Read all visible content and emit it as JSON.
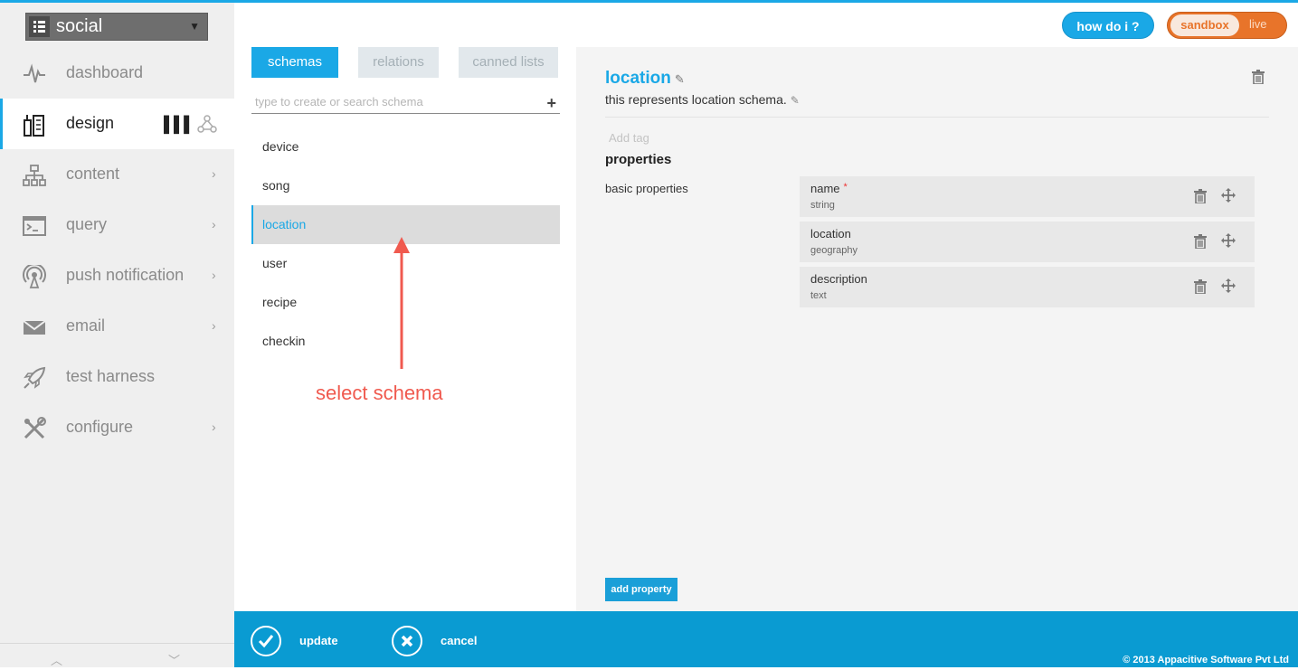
{
  "app_selector": {
    "label": "social"
  },
  "nav": [
    {
      "label": "dashboard",
      "icon": "pulse-icon",
      "chevron": false
    },
    {
      "label": "design",
      "icon": "design-icon",
      "chevron": false,
      "active": true
    },
    {
      "label": "content",
      "icon": "sitemap-icon",
      "chevron": true
    },
    {
      "label": "query",
      "icon": "terminal-icon",
      "chevron": true
    },
    {
      "label": "push notification",
      "icon": "broadcast-icon",
      "chevron": true
    },
    {
      "label": "email",
      "icon": "envelope-icon",
      "chevron": true
    },
    {
      "label": "test harness",
      "icon": "rocket-icon",
      "chevron": false
    },
    {
      "label": "configure",
      "icon": "tools-icon",
      "chevron": true
    }
  ],
  "tabs": {
    "schemas": "schemas",
    "relations": "relations",
    "canned_lists": "canned lists"
  },
  "search": {
    "placeholder": "type to create or search schema"
  },
  "schemas": [
    "device",
    "song",
    "location",
    "user",
    "recipe",
    "checkin"
  ],
  "annotation": "select schema",
  "detail": {
    "title": "location",
    "description": "this represents location schema.",
    "add_tag_placeholder": "Add tag",
    "properties_heading": "properties",
    "basic_properties_label": "basic properties",
    "properties": [
      {
        "name": "name",
        "type": "string",
        "required": "*"
      },
      {
        "name": "location",
        "type": "geography",
        "required": ""
      },
      {
        "name": "description",
        "type": "text",
        "required": ""
      }
    ],
    "add_property_label": "add property"
  },
  "top": {
    "how_do_i": "how do i ?",
    "sandbox": "sandbox",
    "live": "live"
  },
  "bottom": {
    "update": "update",
    "cancel": "cancel",
    "copyright": "© 2013 Appacitive Software Pvt Ltd"
  },
  "colors": {
    "accent": "#1aa8e6",
    "orange": "#e8742a",
    "bottom_bar": "#0a9bd2",
    "annotation": "#f05a4f"
  }
}
